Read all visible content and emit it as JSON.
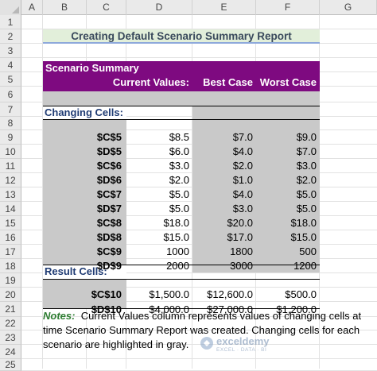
{
  "columns": [
    "A",
    "B",
    "C",
    "D",
    "E",
    "F",
    "G"
  ],
  "rows": [
    "1",
    "2",
    "3",
    "4",
    "5",
    "6",
    "7",
    "8",
    "9",
    "10",
    "11",
    "12",
    "13",
    "14",
    "15",
    "16",
    "17",
    "18",
    "19",
    "20",
    "21",
    "22",
    "23",
    "24",
    "25"
  ],
  "title": "Creating Default Scenario Summary Report",
  "summary": {
    "header": "Scenario Summary",
    "col_current": "Current Values:",
    "col_best": "Best Case",
    "col_worst": "Worst Case",
    "changing_label": "Changing Cells:",
    "changing_rows": [
      {
        "cell": "$C$5",
        "current": "$8.5",
        "best": "$7.0",
        "worst": "$9.0"
      },
      {
        "cell": "$D$5",
        "current": "$6.0",
        "best": "$4.0",
        "worst": "$7.0"
      },
      {
        "cell": "$C$6",
        "current": "$3.0",
        "best": "$2.0",
        "worst": "$3.0"
      },
      {
        "cell": "$D$6",
        "current": "$2.0",
        "best": "$1.0",
        "worst": "$2.0"
      },
      {
        "cell": "$C$7",
        "current": "$5.0",
        "best": "$4.0",
        "worst": "$5.0"
      },
      {
        "cell": "$D$7",
        "current": "$5.0",
        "best": "$3.0",
        "worst": "$5.0"
      },
      {
        "cell": "$C$8",
        "current": "$18.0",
        "best": "$20.0",
        "worst": "$18.0"
      },
      {
        "cell": "$D$8",
        "current": "$15.0",
        "best": "$17.0",
        "worst": "$15.0"
      },
      {
        "cell": "$C$9",
        "current": "1000",
        "best": "1800",
        "worst": "500"
      },
      {
        "cell": "$D$9",
        "current": "2000",
        "best": "3000",
        "worst": "1200"
      }
    ],
    "result_label": "Result Cells:",
    "result_rows": [
      {
        "cell": "$C$10",
        "current": "$1,500.0",
        "best": "$12,600.0",
        "worst": "$500.0"
      },
      {
        "cell": "$D$10",
        "current": "$4,000.0",
        "best": "$27,000.0",
        "worst": "$1,200.0"
      }
    ]
  },
  "notes": {
    "label": "Notes:",
    "line1": "Current Values column represents values of changing cells at",
    "line2": "time Scenario Summary Report was created.  Changing cells for each",
    "line3": "scenario are highlighted in gray."
  },
  "watermark": {
    "brand": "exceldemy",
    "tagline": "EXCEL · DATA · BI"
  },
  "colors": {
    "header_purple": "#7e0a80",
    "changed_gray": "#c9c9c9",
    "title_fill": "#e2efda",
    "label_navy": "#1f3b73",
    "notes_green": "#2e7d32"
  }
}
